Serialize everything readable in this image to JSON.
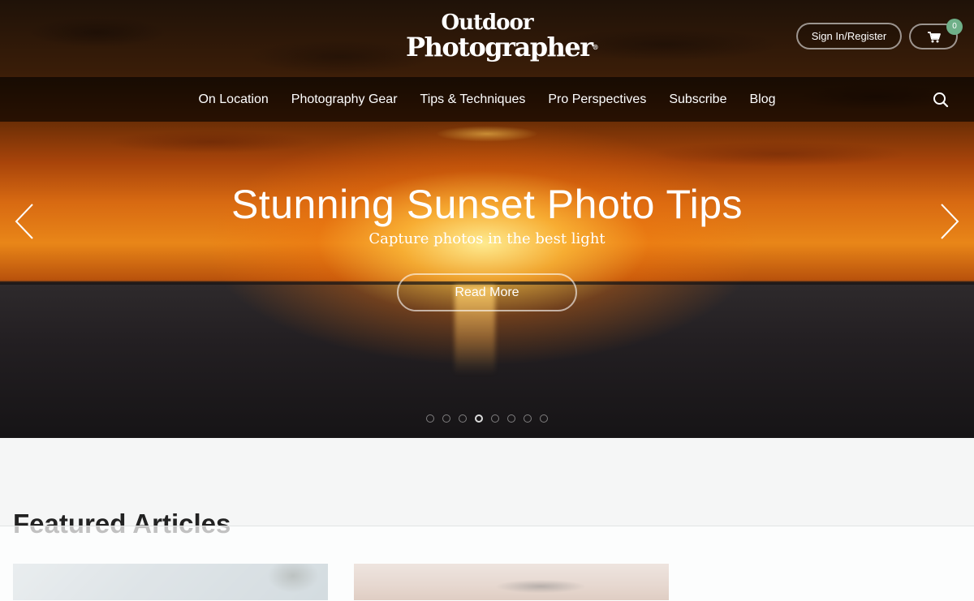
{
  "brand": {
    "logo_line1": "Outdoor",
    "logo_line2": "Photographer",
    "logo_mark": "®"
  },
  "header": {
    "signin_label": "Sign In/Register",
    "cart_icon": "cart-icon",
    "cart_count": "0"
  },
  "nav": {
    "items": [
      {
        "label": "On Location"
      },
      {
        "label": "Photography Gear"
      },
      {
        "label": "Tips & Techniques"
      },
      {
        "label": "Pro Perspectives"
      },
      {
        "label": "Subscribe"
      },
      {
        "label": "Blog"
      }
    ],
    "search_icon": "search-icon"
  },
  "hero": {
    "title": "Stunning Sunset Photo Tips",
    "subtitle": "Capture photos in the best light",
    "button_label": "Read More",
    "prev_icon": "chevron-left-icon",
    "next_icon": "chevron-right-icon",
    "slide_count": 8,
    "active_slide": 4
  },
  "featured": {
    "heading": "Featured Articles"
  },
  "colors": {
    "badge": "#6fb089",
    "nav_background": "rgba(0,0,0,0.62)",
    "page_background": "#f5f6f6"
  }
}
